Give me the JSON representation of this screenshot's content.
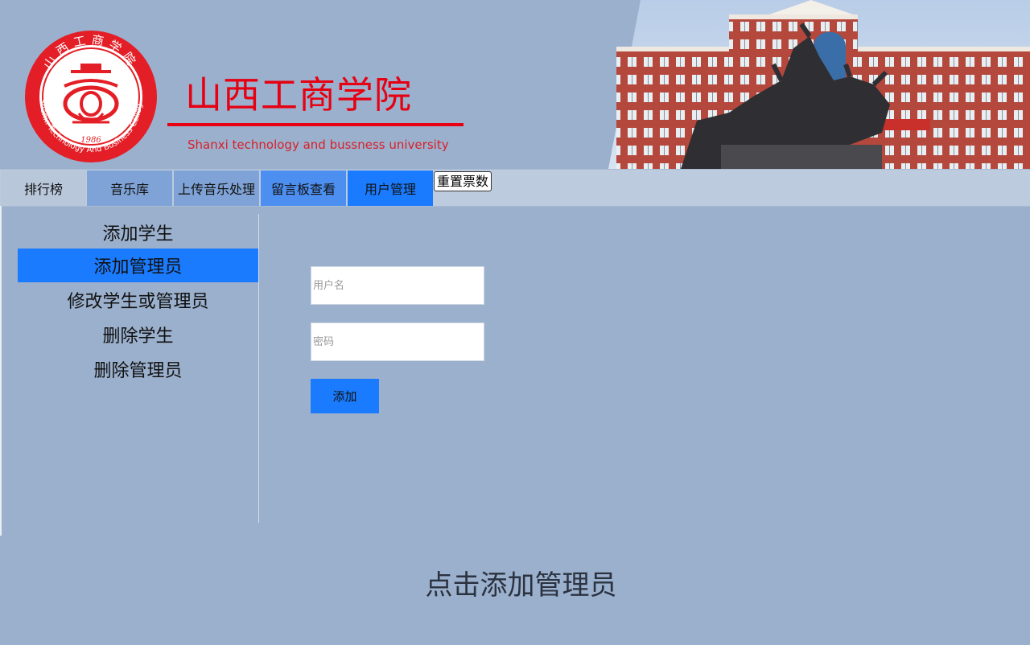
{
  "header": {
    "title": "山西工商学院",
    "subtitle": "Shanxi technology and bussness university",
    "seal": {
      "top_text": "山西工商学院",
      "ring_text": "Shanxi Technology And Business College",
      "year": "1986"
    },
    "photo": "campus-building-with-bull-statue"
  },
  "nav": {
    "items": [
      {
        "label": "排行榜"
      },
      {
        "label": "音乐库"
      },
      {
        "label": "上传音乐处理"
      },
      {
        "label": "留言板查看"
      },
      {
        "label": "用户管理"
      }
    ],
    "reset_label": "重置票数"
  },
  "sidebar": {
    "items": [
      {
        "label": "添加学生"
      },
      {
        "label": "添加管理员",
        "active": true
      },
      {
        "label": "修改学生或管理员"
      },
      {
        "label": "删除学生"
      },
      {
        "label": "删除管理员"
      }
    ]
  },
  "form": {
    "username_placeholder": "用户名",
    "password_placeholder": "密码",
    "submit_label": "添加"
  },
  "footer": {
    "hint": "点击添加管理员"
  },
  "colors": {
    "page_bg": "#9bb0cd",
    "brand_red": "#e60012",
    "active_blue": "#1a7bff"
  }
}
